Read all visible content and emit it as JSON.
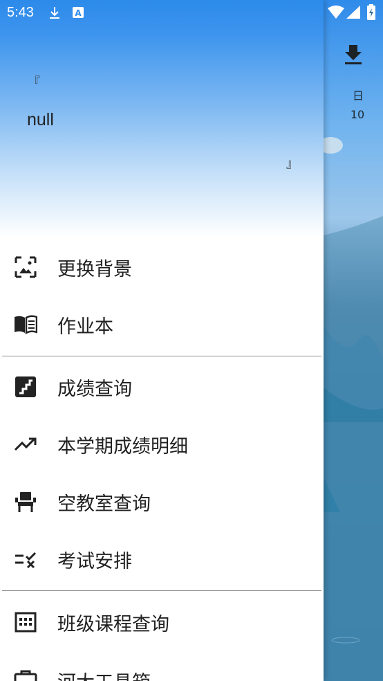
{
  "status_bar": {
    "time": "5:43",
    "icons": [
      "download-icon",
      "text-a-icon",
      "wifi-icon",
      "signal-icon",
      "battery-charging-icon"
    ]
  },
  "background_app": {
    "day_label": "日",
    "day_number": "10"
  },
  "drawer": {
    "header": {
      "quote_open": "『",
      "quote_text": "null",
      "quote_close": "』"
    },
    "items": [
      {
        "label": "更换背景",
        "icon": "wallpaper-icon"
      },
      {
        "label": "作业本",
        "icon": "book-icon"
      },
      {
        "label": "成绩查询",
        "icon": "stairs-icon"
      },
      {
        "label": "本学期成绩明细",
        "icon": "trending-up-icon"
      },
      {
        "label": "空教室查询",
        "icon": "seat-icon"
      },
      {
        "label": "考试安排",
        "icon": "rule-check-icon"
      },
      {
        "label": "班级课程查询",
        "icon": "calendar-grid-icon"
      },
      {
        "label": "河大工具箱",
        "icon": "toolbox-icon"
      }
    ]
  },
  "colors": {
    "header_top": "#2c8aea",
    "drawer_bg": "#ffffff",
    "text": "#212121",
    "divider": "#8a8a8a"
  }
}
